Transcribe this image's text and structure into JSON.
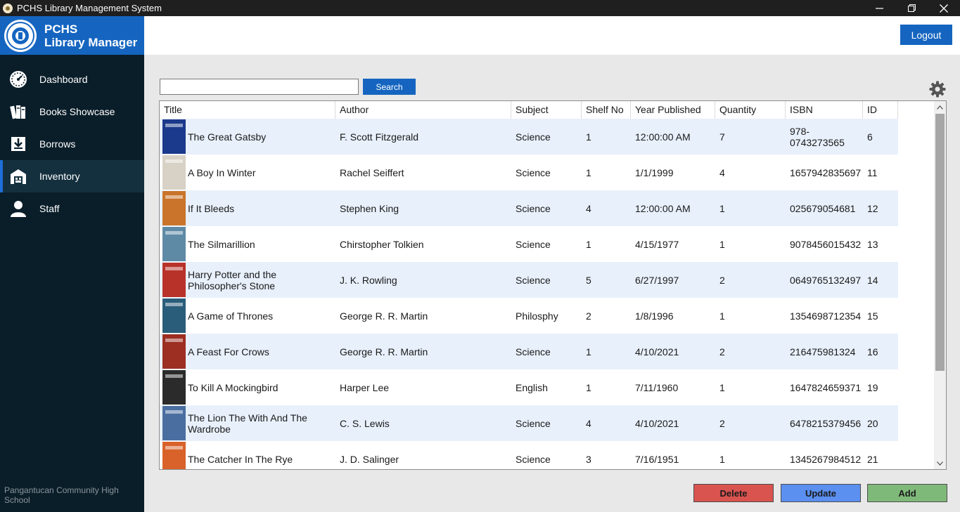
{
  "window": {
    "title": "PCHS Library Management System"
  },
  "brand": {
    "line1": "PCHS",
    "line2": "Library Manager"
  },
  "nav": [
    {
      "label": "Dashboard",
      "icon": "speedometer-icon"
    },
    {
      "label": "Books Showcase",
      "icon": "books-icon"
    },
    {
      "label": "Borrows",
      "icon": "borrow-icon"
    },
    {
      "label": "Inventory",
      "icon": "warehouse-icon",
      "active": true
    },
    {
      "label": "Staff",
      "icon": "user-icon"
    }
  ],
  "footer": {
    "school": "Pangantucan Community High School"
  },
  "header": {
    "logout_label": "Logout"
  },
  "search": {
    "value": "",
    "button_label": "Search"
  },
  "table": {
    "columns": [
      "Title",
      "Author",
      "Subject",
      "Shelf No",
      "Year Published",
      "Quantity",
      "ISBN",
      "ID"
    ],
    "rows": [
      {
        "title": "The Great Gatsby",
        "author": "F. Scott Fitzgerald",
        "subject": "Science",
        "shelf": "1",
        "year": "12:00:00 AM",
        "qty": "7",
        "isbn": "978-0743273565",
        "id": "6",
        "cover": "#1b3a8c"
      },
      {
        "title": "A Boy In Winter",
        "author": "Rachel Seiffert",
        "subject": "Science",
        "shelf": "1",
        "year": "1/1/1999",
        "qty": "4",
        "isbn": "1657942835697",
        "id": "11",
        "cover": "#d8d2c6"
      },
      {
        "title": "If It Bleeds",
        "author": "Stephen King",
        "subject": "Science",
        "shelf": "4",
        "year": "12:00:00 AM",
        "qty": "1",
        "isbn": "025679054681",
        "id": "12",
        "cover": "#c9742a"
      },
      {
        "title": "The Silmarillion",
        "author": "Chirstopher Tolkien",
        "subject": "Science",
        "shelf": "1",
        "year": "4/15/1977",
        "qty": "1",
        "isbn": "9078456015432",
        "id": "13",
        "cover": "#5f8aa6"
      },
      {
        "title": "Harry Potter and the Philosopher's Stone",
        "author": "J. K. Rowling",
        "subject": "Science",
        "shelf": "5",
        "year": "6/27/1997",
        "qty": "2",
        "isbn": "0649765132497",
        "id": "14",
        "cover": "#b8322a"
      },
      {
        "title": "A Game of Thrones",
        "author": "George R. R. Martin",
        "subject": "Philosphy",
        "shelf": "2",
        "year": "1/8/1996",
        "qty": "1",
        "isbn": "1354698712354",
        "id": "15",
        "cover": "#2a5d7a"
      },
      {
        "title": "A Feast For Crows",
        "author": "George R. R. Martin",
        "subject": "Science",
        "shelf": "1",
        "year": "4/10/2021",
        "qty": "2",
        "isbn": "216475981324",
        "id": "16",
        "cover": "#9c2e22"
      },
      {
        "title": "To Kill A Mockingbird",
        "author": "Harper Lee",
        "subject": "English",
        "shelf": "1",
        "year": "7/11/1960",
        "qty": "1",
        "isbn": "1647824659371",
        "id": "19",
        "cover": "#2b2b2b"
      },
      {
        "title": "The Lion The With And The Wardrobe",
        "author": "C. S. Lewis",
        "subject": "Science",
        "shelf": "4",
        "year": "4/10/2021",
        "qty": "2",
        "isbn": "6478215379456",
        "id": "20",
        "cover": "#4a6ea0"
      },
      {
        "title": "The Catcher In The Rye",
        "author": "J. D. Salinger",
        "subject": "Science",
        "shelf": "3",
        "year": "7/16/1951",
        "qty": "1",
        "isbn": "1345267984512",
        "id": "21",
        "cover": "#d8622a"
      }
    ]
  },
  "actions": {
    "delete_label": "Delete",
    "update_label": "Update",
    "add_label": "Add"
  },
  "colors": {
    "accent": "#1565c0",
    "sidebar": "#0a1e2a",
    "row_alt": "#e8f0fb",
    "delete": "#d9534f",
    "update": "#5b8ff0",
    "add": "#7fb97a"
  }
}
